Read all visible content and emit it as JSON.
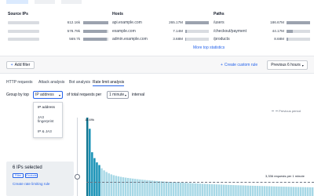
{
  "stats": {
    "source_ips": {
      "title": "Source IPs",
      "rows": [
        {
          "value": "612.16k",
          "fill": 1.0
        },
        {
          "value": "578.79k",
          "fill": 0.95
        },
        {
          "value": "569.7k",
          "fill": 0.93
        }
      ]
    },
    "hosts": {
      "title": "Hosts",
      "rows": [
        {
          "label": "api.example.com",
          "value": "265.17M",
          "fill": 1.0
        },
        {
          "label": "example.com",
          "value": "7.14M",
          "fill": 0.05
        },
        {
          "label": "admin.example.com",
          "value": "3.68M",
          "fill": 0.03
        }
      ]
    },
    "paths": {
      "title": "Paths",
      "rows": [
        {
          "label": "/users",
          "value": "186.67M",
          "fill": 1.0
        },
        {
          "label": "/checkout/payment",
          "value": "44.17M",
          "fill": 0.25
        },
        {
          "label": "/products",
          "value": "8.68M",
          "fill": 0.06
        }
      ]
    },
    "more_link": "More top statistics"
  },
  "filterbar": {
    "add_filter": "Add filter",
    "create_rule": "Create custom rule",
    "time_range": "Previous 6 hours"
  },
  "tabs": [
    "HTTP requests",
    "Attack analysis",
    "Bot analysis",
    "Rate limit analysis"
  ],
  "active_tab": 3,
  "groupby": {
    "prefix": "Group by top",
    "selected": "IP address",
    "middle": "of total requests per",
    "interval": "1 minute",
    "suffix": "interval",
    "options": [
      "IP address",
      "JA3 fingerprint",
      "IP & JA3"
    ]
  },
  "chart": {
    "peak_label": "14.69k",
    "previous_label": "Previous period",
    "threshold_label": "3,336 requests per 1 minute",
    "bar_color": "#0e7490",
    "selected_bar_color": "#1590b5",
    "unselected_bar_color": "#a7d8e6",
    "threshold": 3336,
    "ymax": 14690,
    "selected_count": 6,
    "values": [
      14690,
      12600,
      8200,
      7100,
      6300,
      5800,
      5200,
      4800,
      4500,
      4250,
      4050,
      3900,
      3780,
      3680,
      3590,
      3510,
      3440,
      3380,
      3320,
      3260,
      3200,
      3150,
      3100,
      3050,
      3005,
      2965,
      2925,
      2885,
      2850,
      2815,
      2780,
      2748,
      2716,
      2685,
      2655,
      2625,
      2596,
      2568,
      2540,
      2513,
      2487,
      2461,
      2436,
      2411,
      2387,
      2363,
      2340,
      2317,
      2295,
      2273,
      2252,
      2231,
      2211,
      2191,
      2171,
      2152,
      2133,
      2115,
      2097,
      2079,
      2062,
      2045,
      2028,
      2012,
      1996,
      1980,
      1965,
      1950,
      1935,
      1920,
      1906,
      1892,
      1878,
      1864,
      1851,
      1838,
      1825,
      1812,
      1800,
      1788,
      1776,
      1764,
      1752,
      1741,
      1730,
      1719,
      1708,
      1697,
      1687,
      1677,
      1667,
      1657,
      1647,
      1637,
      1628
    ]
  },
  "selection": {
    "title": "6 IPs selected",
    "filter_btn": "Filter",
    "exclude_btn": "Exclude",
    "create_link": "Create rate limiting rule"
  }
}
